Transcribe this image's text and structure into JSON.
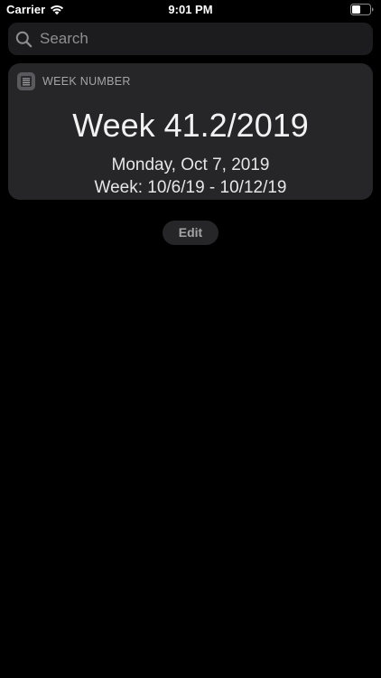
{
  "status_bar": {
    "carrier": "Carrier",
    "time": "9:01 PM"
  },
  "search": {
    "placeholder": "Search",
    "value": ""
  },
  "widget": {
    "title": "WEEK NUMBER",
    "week": "Week 41.2/2019",
    "date": "Monday, Oct 7, 2019",
    "range": "Week: 10/6/19 - 10/12/19",
    "icon": "calendar-list-icon"
  },
  "edit_label": "Edit",
  "colors": {
    "background": "#000000",
    "card": "#262628",
    "search_field": "#1c1c1e",
    "secondary_text": "#a4a4a8"
  }
}
